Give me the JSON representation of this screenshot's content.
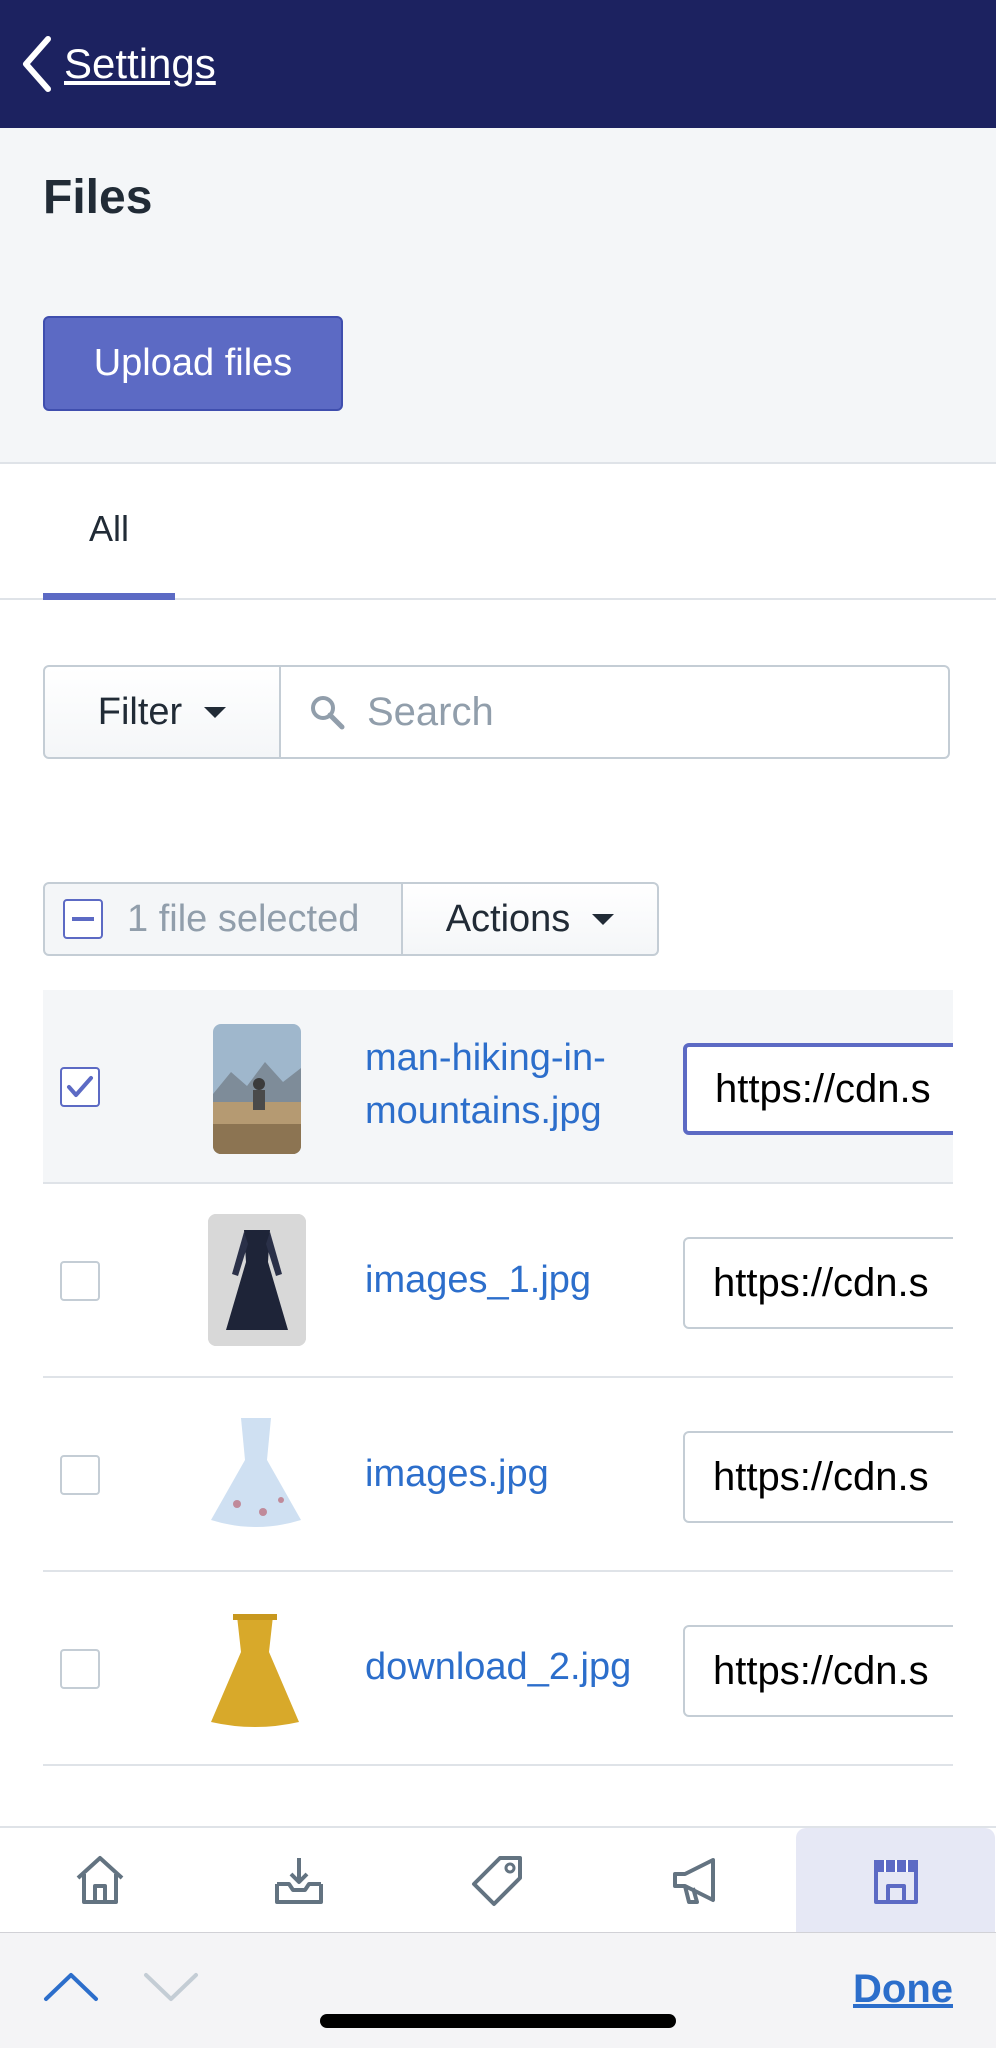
{
  "nav": {
    "back_label": "Settings"
  },
  "page": {
    "title": "Files",
    "upload_label": "Upload files"
  },
  "tabs": [
    {
      "label": "All",
      "active": true
    }
  ],
  "filter": {
    "label": "Filter",
    "search_placeholder": "Search"
  },
  "bulk": {
    "selected_text": "1 file selected",
    "actions_label": "Actions"
  },
  "files": [
    {
      "name": "man-hiking-in-mountains.jpg",
      "url": "https://cdn.s",
      "selected": true,
      "thumb": "photo-thumbnail"
    },
    {
      "name": "images_1.jpg",
      "url": "https://cdn.s",
      "selected": false,
      "thumb": "navy-dress-thumbnail"
    },
    {
      "name": "images.jpg",
      "url": "https://cdn.s",
      "selected": false,
      "thumb": "light-blue-dress-thumbnail"
    },
    {
      "name": "download_2.jpg",
      "url": "https://cdn.s",
      "selected": false,
      "thumb": "yellow-dress-thumbnail"
    }
  ],
  "tabbar": [
    {
      "icon": "home-icon"
    },
    {
      "icon": "orders-icon"
    },
    {
      "icon": "products-tag-icon"
    },
    {
      "icon": "marketing-icon"
    },
    {
      "icon": "store-icon",
      "active": true
    }
  ],
  "keyboard": {
    "done_label": "Done"
  },
  "colors": {
    "nav_bg": "#1c2260",
    "accent": "#5c6ac4",
    "link": "#2c6ecb"
  }
}
